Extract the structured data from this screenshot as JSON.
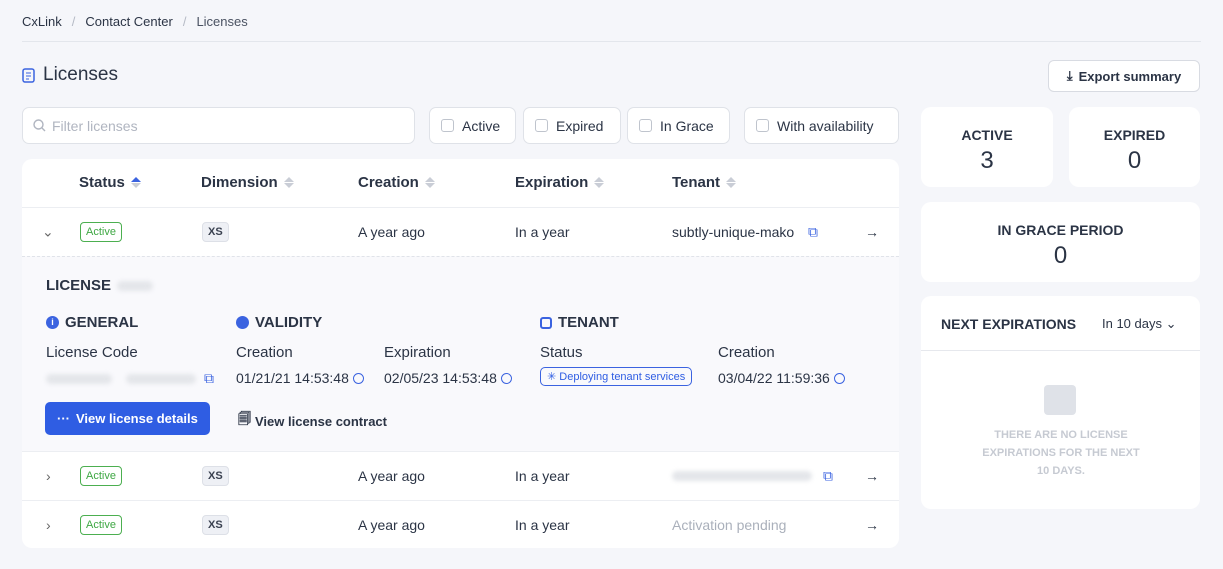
{
  "breadcrumb": [
    "CxLink",
    "Contact Center",
    "Licenses"
  ],
  "page_title": "Licenses",
  "export_label": "Export summary",
  "search": {
    "placeholder": "Filter licenses",
    "value": ""
  },
  "filters": [
    "Active",
    "Expired",
    "In Grace",
    "With availability"
  ],
  "columns": [
    "Status",
    "Dimension",
    "Creation",
    "Expiration",
    "Tenant"
  ],
  "rows": [
    {
      "status": "Active",
      "dimension": "XS",
      "creation": "A year ago",
      "expiration": "In a year",
      "tenant": "subtly-unique-mako"
    },
    {
      "status": "Active",
      "dimension": "XS",
      "creation": "A year ago",
      "expiration": "In a year",
      "tenant": ""
    },
    {
      "status": "Active",
      "dimension": "XS",
      "creation": "A year ago",
      "expiration": "In a year",
      "tenant": "Activation pending"
    }
  ],
  "detail": {
    "license_label": "LICENSE",
    "general": "GENERAL",
    "validity": "VALIDITY",
    "tenant": "TENANT",
    "license_code_label": "License Code",
    "creation_label": "Creation",
    "expiration_label": "Expiration",
    "status_label": "Status",
    "creation": "01/21/21 14:53:48",
    "expiration": "02/05/23 14:53:48",
    "tenant_status": "Deploying tenant services",
    "tenant_creation": "03/04/22 11:59:36",
    "view_details": "View license details",
    "view_contract": "View license contract"
  },
  "stats": {
    "active_label": "ACTIVE",
    "active": "3",
    "expired_label": "EXPIRED",
    "expired": "0",
    "grace_label": "IN GRACE PERIOD",
    "grace": "0"
  },
  "next": {
    "title": "NEXT EXPIRATIONS",
    "range": "In 10 days",
    "empty": "THERE ARE NO LICENSE EXPIRATIONS FOR THE NEXT 10 DAYS."
  }
}
